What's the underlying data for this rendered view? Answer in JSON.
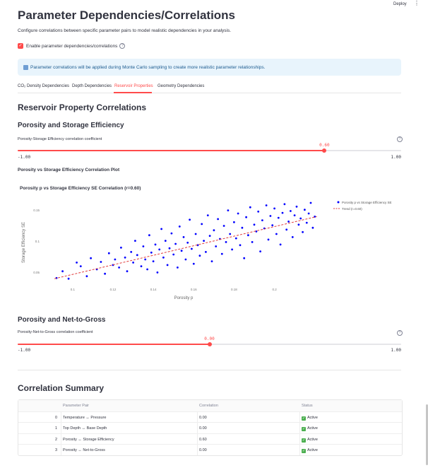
{
  "topbar": {
    "deploy_label": "Deploy",
    "menu_glyph": "⋮"
  },
  "page": {
    "title": "Parameter Dependencies/Correlations",
    "description": "Configure correlations between specific parameter pairs to model realistic dependencies in your analysis.",
    "enable_label": "Enable parameter dependencies/correlations",
    "enable_checked": true,
    "info_text": "Parameter correlations will be applied during Monte Carlo sampling to create more realistic parameter relationships."
  },
  "tabs": [
    {
      "label": "CO₂ Density Dependencies",
      "active": false
    },
    {
      "label": "Depth Dependencies",
      "active": false
    },
    {
      "label": "Reservoir Properties",
      "active": true
    },
    {
      "label": "Geometry Dependencies",
      "active": false
    }
  ],
  "section": {
    "title": "Reservoir Property Correlations"
  },
  "porosity_se": {
    "heading": "Porosity and Storage Efficiency",
    "slider_label": "Porosity-Storage Efficiency correlation coefficient",
    "value": 0.6,
    "value_text": "0.60",
    "min_text": "-1.00",
    "max_text": "1.00",
    "min": -1,
    "max": 1,
    "plot_label": "Porosity vs Storage Efficiency Correlation Plot"
  },
  "chart_data": {
    "type": "scatter",
    "title": "Porosity p vs Storage Efficiency SE Correlation (r=0.60)",
    "xlabel": "Porosity p",
    "ylabel": "Storage Efficiency SE",
    "xlim": [
      0.085,
      0.225
    ],
    "ylim": [
      0.03,
      0.17
    ],
    "xticks": [
      0.1,
      0.12,
      0.14,
      0.16,
      0.18,
      0.2
    ],
    "xtick_labels": [
      "0.1",
      "0.12",
      "0.14",
      "0.16",
      "0.18",
      "0.2"
    ],
    "yticks": [
      0.05,
      0.1,
      0.15
    ],
    "ytick_labels": [
      "0.05",
      "0.1",
      "0.15"
    ],
    "legend_position": "outside-top-right",
    "series": [
      {
        "name": "Porosity p vs Storage Efficiency SE",
        "kind": "scatter",
        "color": "#0000ff",
        "points": [
          [
            0.092,
            0.041
          ],
          [
            0.095,
            0.052
          ],
          [
            0.098,
            0.04
          ],
          [
            0.102,
            0.066
          ],
          [
            0.104,
            0.06
          ],
          [
            0.107,
            0.044
          ],
          [
            0.109,
            0.073
          ],
          [
            0.112,
            0.055
          ],
          [
            0.114,
            0.067
          ],
          [
            0.116,
            0.048
          ],
          [
            0.118,
            0.081
          ],
          [
            0.12,
            0.062
          ],
          [
            0.121,
            0.071
          ],
          [
            0.123,
            0.058
          ],
          [
            0.124,
            0.09
          ],
          [
            0.126,
            0.074
          ],
          [
            0.127,
            0.052
          ],
          [
            0.129,
            0.083
          ],
          [
            0.13,
            0.066
          ],
          [
            0.131,
            0.101
          ],
          [
            0.132,
            0.078
          ],
          [
            0.134,
            0.06
          ],
          [
            0.135,
            0.092
          ],
          [
            0.136,
            0.071
          ],
          [
            0.137,
            0.055
          ],
          [
            0.138,
            0.11
          ],
          [
            0.139,
            0.082
          ],
          [
            0.14,
            0.068
          ],
          [
            0.141,
            0.095
          ],
          [
            0.142,
            0.05
          ],
          [
            0.143,
            0.087
          ],
          [
            0.144,
            0.12
          ],
          [
            0.145,
            0.074
          ],
          [
            0.146,
            0.101
          ],
          [
            0.147,
            0.062
          ],
          [
            0.148,
            0.089
          ],
          [
            0.149,
            0.113
          ],
          [
            0.15,
            0.079
          ],
          [
            0.151,
            0.096
          ],
          [
            0.152,
            0.058
          ],
          [
            0.153,
            0.124
          ],
          [
            0.154,
            0.085
          ],
          [
            0.155,
            0.107
          ],
          [
            0.156,
            0.071
          ],
          [
            0.157,
            0.098
          ],
          [
            0.158,
            0.135
          ],
          [
            0.159,
            0.088
          ],
          [
            0.16,
            0.064
          ],
          [
            0.161,
            0.112
          ],
          [
            0.162,
            0.094
          ],
          [
            0.163,
            0.077
          ],
          [
            0.164,
            0.128
          ],
          [
            0.165,
            0.101
          ],
          [
            0.166,
            0.083
          ],
          [
            0.167,
            0.142
          ],
          [
            0.168,
            0.109
          ],
          [
            0.169,
            0.068
          ],
          [
            0.17,
            0.118
          ],
          [
            0.171,
            0.092
          ],
          [
            0.172,
            0.136
          ],
          [
            0.173,
            0.104
          ],
          [
            0.174,
            0.08
          ],
          [
            0.175,
            0.125
          ],
          [
            0.176,
            0.099
          ],
          [
            0.177,
            0.15
          ],
          [
            0.178,
            0.112
          ],
          [
            0.179,
            0.087
          ],
          [
            0.18,
            0.131
          ],
          [
            0.181,
            0.105
          ],
          [
            0.182,
            0.145
          ],
          [
            0.183,
            0.094
          ],
          [
            0.184,
            0.122
          ],
          [
            0.185,
            0.073
          ],
          [
            0.186,
            0.139
          ],
          [
            0.187,
            0.11
          ],
          [
            0.188,
            0.155
          ],
          [
            0.189,
            0.099
          ],
          [
            0.19,
            0.127
          ],
          [
            0.191,
            0.116
          ],
          [
            0.192,
            0.148
          ],
          [
            0.193,
            0.084
          ],
          [
            0.194,
            0.134
          ],
          [
            0.195,
            0.121
          ],
          [
            0.196,
            0.158
          ],
          [
            0.197,
            0.103
          ],
          [
            0.198,
            0.141
          ],
          [
            0.199,
            0.126
          ],
          [
            0.2,
            0.153
          ],
          [
            0.201,
            0.112
          ],
          [
            0.202,
            0.138
          ],
          [
            0.203,
            0.095
          ],
          [
            0.204,
            0.146
          ],
          [
            0.205,
            0.16
          ],
          [
            0.206,
            0.119
          ],
          [
            0.207,
            0.132
          ],
          [
            0.208,
            0.149
          ],
          [
            0.209,
            0.107
          ],
          [
            0.21,
            0.142
          ],
          [
            0.211,
            0.156
          ],
          [
            0.212,
            0.127
          ],
          [
            0.213,
            0.137
          ],
          [
            0.214,
            0.115
          ],
          [
            0.215,
            0.151
          ],
          [
            0.216,
            0.13
          ],
          [
            0.217,
            0.145
          ],
          [
            0.218,
            0.162
          ],
          [
            0.219,
            0.122
          ],
          [
            0.22,
            0.14
          ]
        ]
      },
      {
        "name": "Trend (r=0.60)",
        "kind": "line",
        "color": "#e03a3a",
        "points": [
          [
            0.091,
            0.04
          ],
          [
            0.221,
            0.14
          ]
        ]
      }
    ]
  },
  "porosity_ntg": {
    "heading": "Porosity and Net-to-Gross",
    "slider_label": "Porosity-Net-to-Gross correlation coefficient",
    "value": 0.0,
    "value_text": "0.00",
    "min_text": "-1.00",
    "max_text": "1.00",
    "min": -1,
    "max": 1
  },
  "summary": {
    "title": "Correlation Summary",
    "columns": [
      "",
      "Parameter Pair",
      "Correlation",
      "Status"
    ],
    "rows": [
      {
        "idx": "0",
        "pair": "Temperature ↔ Pressure",
        "corr": "0.00",
        "status": "Active"
      },
      {
        "idx": "1",
        "pair": "Top Depth ↔ Base Depth",
        "corr": "0.00",
        "status": "Active"
      },
      {
        "idx": "2",
        "pair": "Porosity ↔ Storage Efficiency",
        "corr": "0.60",
        "status": "Active"
      },
      {
        "idx": "3",
        "pair": "Porosity ↔ Net-to-Gross",
        "corr": "0.00",
        "status": "Active"
      }
    ]
  }
}
